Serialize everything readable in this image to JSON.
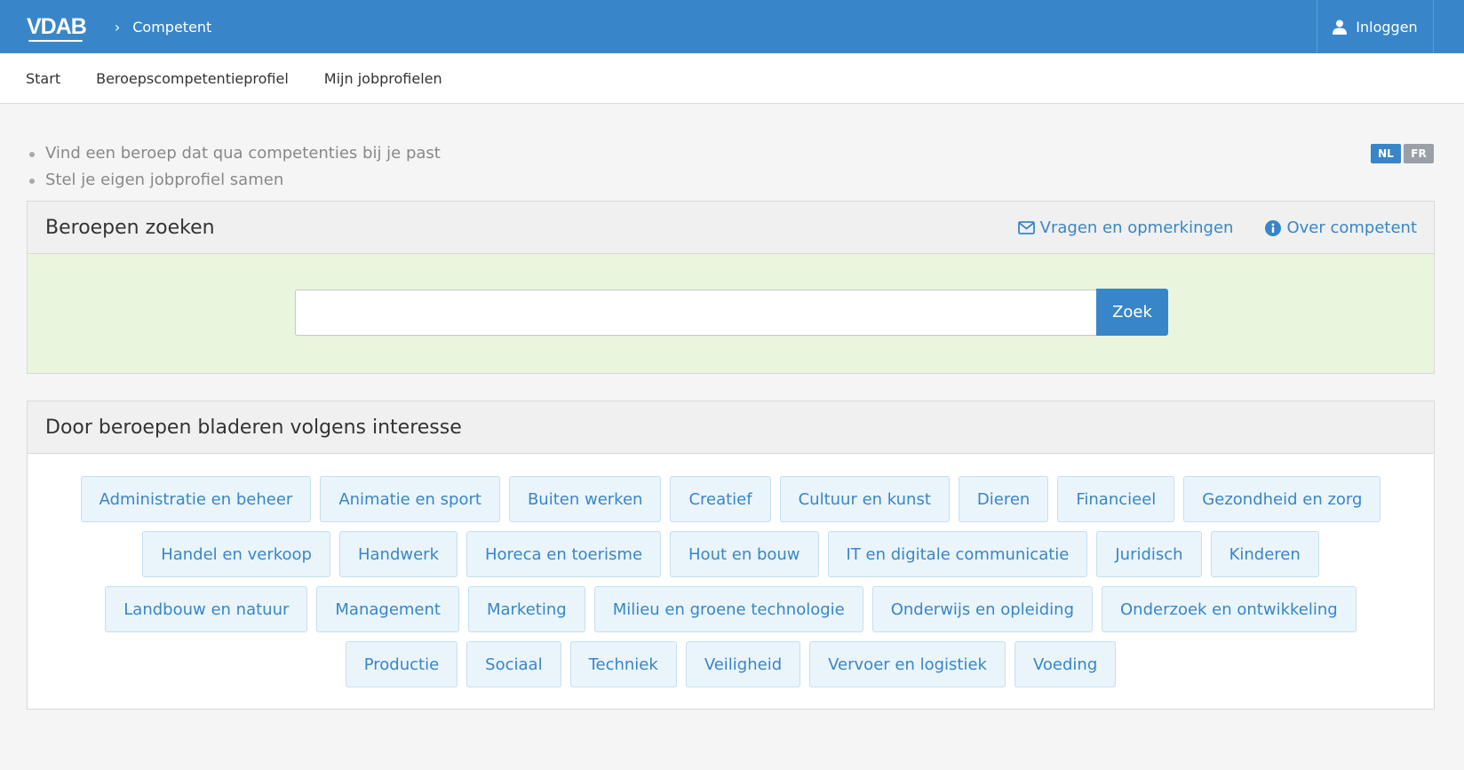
{
  "header": {
    "logo": "VDAB",
    "breadcrumb_sep": "›",
    "breadcrumb": "Competent",
    "login_label": "Inloggen"
  },
  "subnav": {
    "items": [
      "Start",
      "Beroepscompetentieprofiel",
      "Mijn jobprofielen"
    ]
  },
  "intro": {
    "items": [
      "Vind een beroep dat qua competenties bij je past",
      "Stel je eigen jobprofiel samen"
    ]
  },
  "lang": {
    "nl": "NL",
    "fr": "FR",
    "active": "NL"
  },
  "search_panel": {
    "title": "Beroepen zoeken",
    "link_feedback": "Vragen en opmerkingen",
    "link_about": "Over competent",
    "search_value": "",
    "search_button": "Zoek"
  },
  "browse_panel": {
    "title": "Door beroepen bladeren volgens interesse",
    "tags": [
      "Administratie en beheer",
      "Animatie en sport",
      "Buiten werken",
      "Creatief",
      "Cultuur en kunst",
      "Dieren",
      "Financieel",
      "Gezondheid en zorg",
      "Handel en verkoop",
      "Handwerk",
      "Horeca en toerisme",
      "Hout en bouw",
      "IT en digitale communicatie",
      "Juridisch",
      "Kinderen",
      "Landbouw en natuur",
      "Management",
      "Marketing",
      "Milieu en groene technologie",
      "Onderwijs en opleiding",
      "Onderzoek en ontwikkeling",
      "Productie",
      "Sociaal",
      "Techniek",
      "Veiligheid",
      "Vervoer en logistiek",
      "Voeding"
    ]
  },
  "colors": {
    "brand": "#3886c9",
    "search_bg": "#e9f5dd",
    "tag_bg": "#eaf4fb"
  }
}
